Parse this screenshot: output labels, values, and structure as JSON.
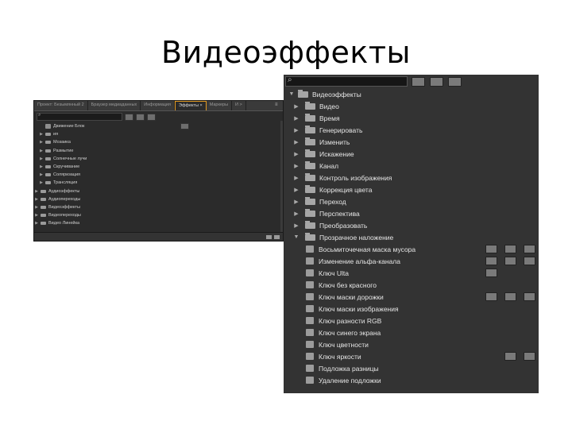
{
  "slide": {
    "title": "Видеоэффекты"
  },
  "small_panel": {
    "tabs": [
      {
        "label": "Проект: Безымянный 2",
        "active": false
      },
      {
        "label": "Браузер медиаданных",
        "active": false
      },
      {
        "label": "Информация",
        "active": false
      },
      {
        "label": "Эффекты ×",
        "active": true
      },
      {
        "label": "Маркеры",
        "active": false
      },
      {
        "label": "И >",
        "active": false
      }
    ],
    "items": [
      {
        "label": "Движение Блок",
        "kind": "preset",
        "indent": 1
      },
      {
        "label": "ия",
        "kind": "folder",
        "indent": 1
      },
      {
        "label": "Мозаика",
        "kind": "folder",
        "indent": 1
      },
      {
        "label": "Размытие",
        "kind": "folder",
        "indent": 1
      },
      {
        "label": "Солнечные лучи",
        "kind": "folder",
        "indent": 1
      },
      {
        "label": "Скручивание",
        "kind": "folder",
        "indent": 1
      },
      {
        "label": "Соляризация",
        "kind": "folder",
        "indent": 1
      },
      {
        "label": "Трансляция",
        "kind": "folder",
        "indent": 1
      },
      {
        "label": "Аудиоэффекты",
        "kind": "folder",
        "indent": 0
      },
      {
        "label": "Аудиопереходы",
        "kind": "folder",
        "indent": 0
      },
      {
        "label": "Видеоэффекты",
        "kind": "folder",
        "indent": 0
      },
      {
        "label": "Видеопереходы",
        "kind": "folder",
        "indent": 0
      },
      {
        "label": "Видео Линейка",
        "kind": "folder",
        "indent": 0
      }
    ]
  },
  "big_panel": {
    "root": "Видеоэффекты",
    "folders": [
      "Видео",
      "Время",
      "Генерировать",
      "Изменить",
      "Искажение",
      "Канал",
      "Контроль изображения",
      "Коррекция цвета",
      "Переход",
      "Перспектива",
      "Преобразовать"
    ],
    "open_folder": "Прозрачное наложение",
    "effects": [
      {
        "label": "Восьмиточечная маска мусора",
        "badges": [
          true,
          true,
          true
        ]
      },
      {
        "label": "Изменение альфа-канала",
        "badges": [
          true,
          true,
          true
        ]
      },
      {
        "label": "Ключ Ulta",
        "badges": [
          true,
          false,
          false
        ]
      },
      {
        "label": "Ключ без красного",
        "badges": [
          false,
          false,
          false
        ]
      },
      {
        "label": "Ключ маски дорожки",
        "badges": [
          true,
          true,
          true
        ]
      },
      {
        "label": "Ключ маски изображения",
        "badges": [
          false,
          false,
          false
        ]
      },
      {
        "label": "Ключ разности RGB",
        "badges": [
          false,
          false,
          false
        ]
      },
      {
        "label": "Ключ синего экрана",
        "badges": [
          false,
          false,
          false
        ]
      },
      {
        "label": "Ключ цветности",
        "badges": [
          false,
          false,
          false
        ]
      },
      {
        "label": "Ключ яркости",
        "badges": [
          false,
          true,
          true
        ]
      },
      {
        "label": "Подложка разницы",
        "badges": [
          false,
          false,
          false
        ]
      },
      {
        "label": "Удаление подложки",
        "badges": [
          false,
          false,
          false
        ]
      }
    ]
  }
}
